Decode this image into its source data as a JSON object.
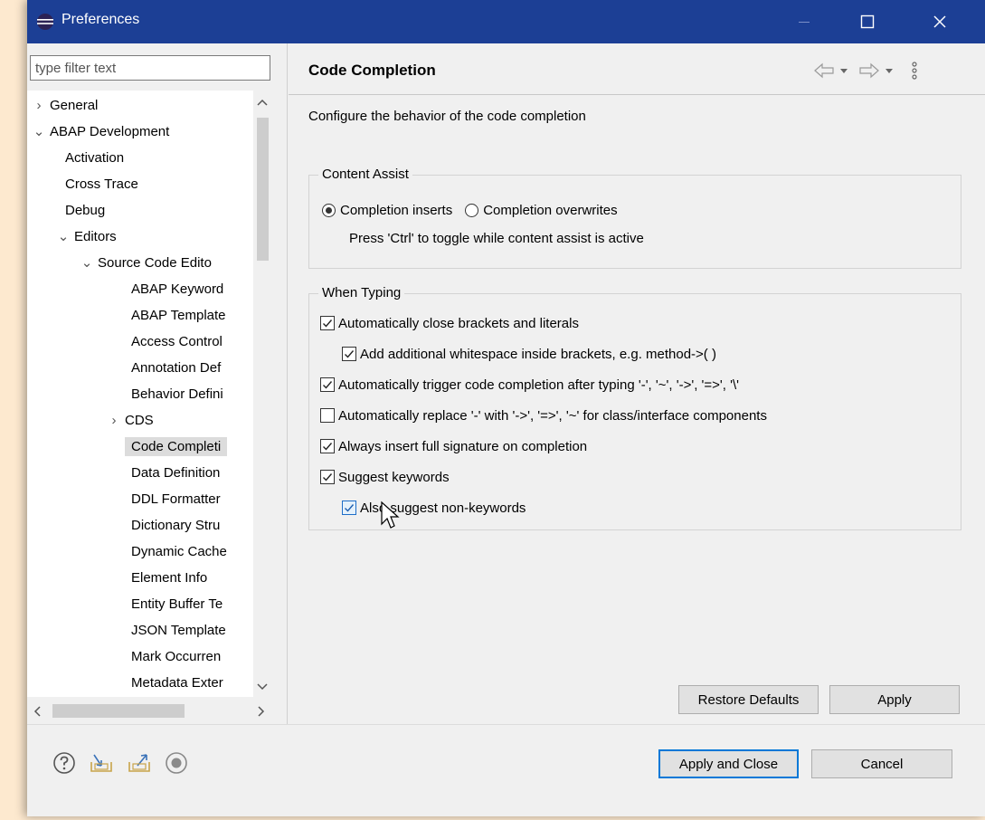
{
  "window": {
    "title": "Preferences",
    "title_bar_color": "#1c3f95"
  },
  "filter": {
    "placeholder": "type filter text"
  },
  "tree": {
    "items": [
      {
        "label": "General",
        "twisty": "›"
      },
      {
        "label": "ABAP Development",
        "twisty": "⌄"
      },
      {
        "label": "Activation",
        "twisty": ""
      },
      {
        "label": "Cross Trace",
        "twisty": ""
      },
      {
        "label": "Debug",
        "twisty": ""
      },
      {
        "label": "Editors",
        "twisty": "⌄"
      },
      {
        "label": "Source Code Edito",
        "twisty": "⌄"
      },
      {
        "label": "ABAP Keyword",
        "twisty": ""
      },
      {
        "label": "ABAP Template",
        "twisty": ""
      },
      {
        "label": "Access Control",
        "twisty": ""
      },
      {
        "label": "Annotation Def",
        "twisty": ""
      },
      {
        "label": "Behavior Defini",
        "twisty": ""
      },
      {
        "label": "CDS",
        "twisty": "›"
      },
      {
        "label": "Code Completi",
        "twisty": ""
      },
      {
        "label": "Data Definition",
        "twisty": ""
      },
      {
        "label": "DDL Formatter",
        "twisty": ""
      },
      {
        "label": "Dictionary Stru",
        "twisty": ""
      },
      {
        "label": "Dynamic Cache",
        "twisty": ""
      },
      {
        "label": "Element Info",
        "twisty": ""
      },
      {
        "label": "Entity Buffer Te",
        "twisty": ""
      },
      {
        "label": "JSON Template",
        "twisty": ""
      },
      {
        "label": "Mark Occurren",
        "twisty": ""
      },
      {
        "label": "Metadata Exter",
        "twisty": ""
      }
    ]
  },
  "page": {
    "title": "Code Completion",
    "description": "Configure the behavior of the code completion",
    "content_assist": {
      "title": "Content Assist",
      "radio_inserts": "Completion inserts",
      "radio_overwrites": "Completion overwrites",
      "hint": "Press 'Ctrl' to toggle while content assist is active"
    },
    "when_typing": {
      "title": "When Typing",
      "close_brackets": "Automatically close brackets and literals",
      "whitespace": "Add additional whitespace inside brackets, e.g. method->( )",
      "trigger": "Automatically trigger code completion after typing '-', '~', '->', '=>', '\\'",
      "replace": "Automatically replace '-' with '->', '=>', '~' for class/interface components",
      "full_signature": "Always insert full signature on completion",
      "suggest_keywords": "Suggest keywords",
      "non_keywords": "Also suggest non-keywords"
    }
  },
  "buttons": {
    "restore_defaults": "Restore Defaults",
    "apply": "Apply",
    "apply_and_close": "Apply and Close",
    "cancel": "Cancel"
  },
  "colors": {
    "default_button_border": "#0078d7",
    "selection": "#dcdcdc"
  }
}
